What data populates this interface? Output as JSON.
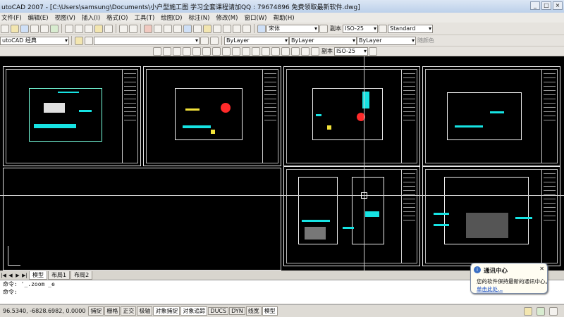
{
  "window": {
    "title": "utoCAD 2007 - [C:\\Users\\samsung\\Documents\\小户型施工图 学习全套课程请加QQ : 79674896 免费领取最新软件.dwg]",
    "controls": [
      "_",
      "□",
      "×"
    ]
  },
  "menu": [
    "文件(F)",
    "编辑(E)",
    "视图(V)",
    "插入(I)",
    "格式(O)",
    "工具(T)",
    "绘图(D)",
    "标注(N)",
    "修改(M)",
    "窗口(W)",
    "帮助(H)"
  ],
  "toolbar": {
    "font_combo": "宋体",
    "dim_style_combo": "ISO-25",
    "text_style_combo": "Standard",
    "dim_label": "副本",
    "workspace_combo": "utoCAD 经典",
    "layer_color_combo": "ByLayer",
    "linetype_combo": "ByLayer",
    "lineweight_combo": "ByLayer",
    "plot_style": "随颜色",
    "dim_style_combo2": "ISO-25",
    "dim_label2": "副本"
  },
  "layout_tabs": [
    "模型",
    "布局1",
    "布局2"
  ],
  "command_line": [
    "命令: '_.zoom _e",
    "命令:"
  ],
  "status": {
    "coords": "96.5340,  -6828.6982, 0.0000",
    "toggles": [
      "捕捉",
      "栅格",
      "正交",
      "极轴",
      "对象捕捉",
      "对象追踪",
      "DUCS",
      "DYN",
      "线宽",
      "模型"
    ]
  },
  "notification": {
    "title": "通讯中心",
    "body": "您的软件保持最新的通讯中心。",
    "link": "单击此处..."
  }
}
